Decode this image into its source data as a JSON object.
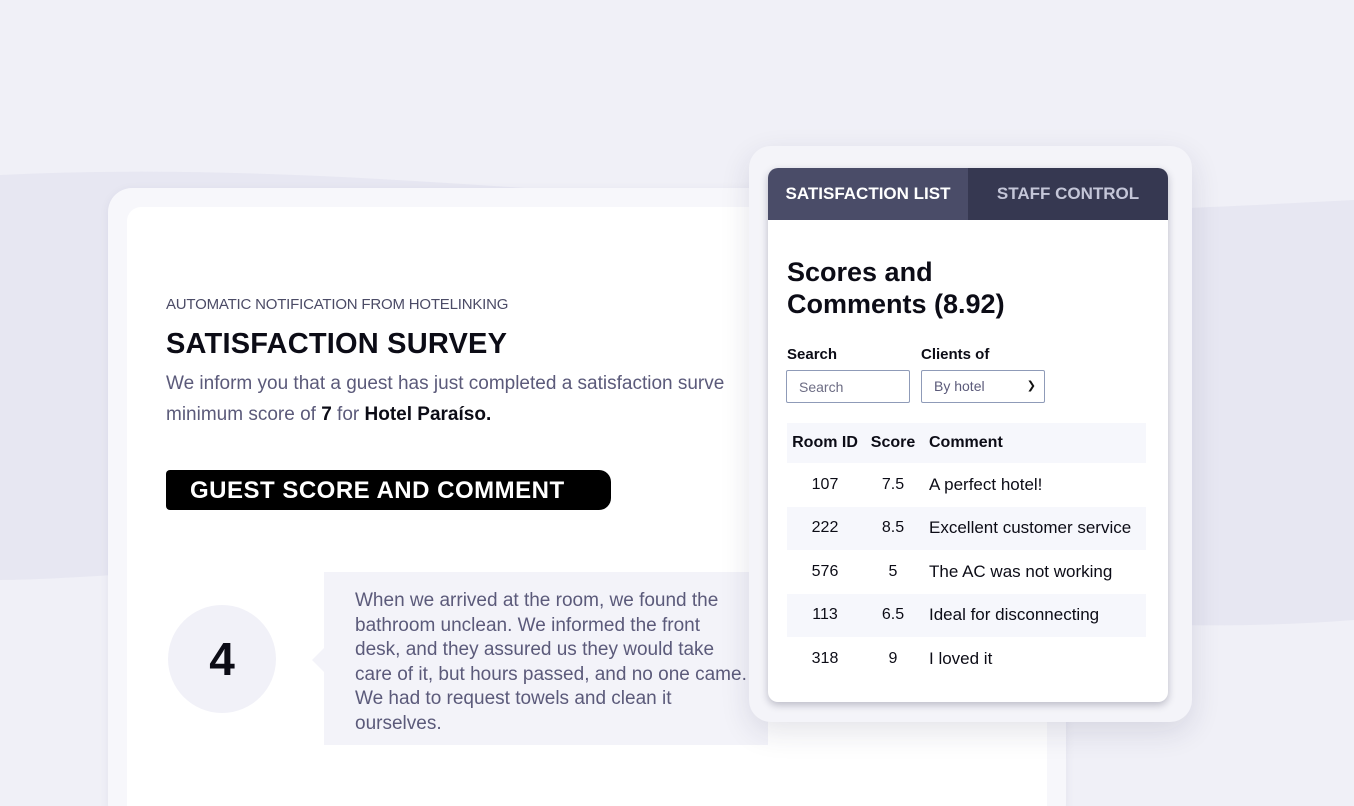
{
  "email": {
    "notification_label": "AUTOMATIC NOTIFICATION FROM HOTELINKING",
    "title": "SATISFACTION SURVEY",
    "inform_prefix": "We inform you that a guest has just completed a satisfaction surve",
    "inform_line2_prefix": "minimum score of ",
    "min_score": "7",
    "inform_for": " for ",
    "hotel_name": "Hotel Paraíso.",
    "banner": "GUEST SCORE AND COMMENT",
    "guest_score": "4",
    "guest_comment": "When we arrived at the room, we found the bathroom unclean. We informed the front desk, and they assured us they would take care of it, but hours passed, and no one came. We had to request towels and clean it ourselves."
  },
  "panel": {
    "tabs": [
      {
        "label": "SATISFACTION LIST",
        "active": true
      },
      {
        "label": "STAFF CONTROL",
        "active": false
      }
    ],
    "title": "Scores and Comments (8.92)",
    "search_label": "Search",
    "search_placeholder": "Search",
    "clients_label": "Clients of",
    "clients_value": "By hotel",
    "table": {
      "headers": [
        "Room ID",
        "Score",
        "Comment"
      ],
      "rows": [
        [
          "107",
          "7.5",
          "A perfect hotel!"
        ],
        [
          "222",
          "8.5",
          "Excellent customer service"
        ],
        [
          "576",
          "5",
          "The AC was not working"
        ],
        [
          "113",
          "6.5",
          "Ideal for disconnecting"
        ],
        [
          "318",
          "9",
          "I loved it"
        ]
      ]
    }
  },
  "colors": {
    "tab_active": "#4a4c68",
    "tab_inactive": "#363851",
    "background": "#ededf6"
  }
}
